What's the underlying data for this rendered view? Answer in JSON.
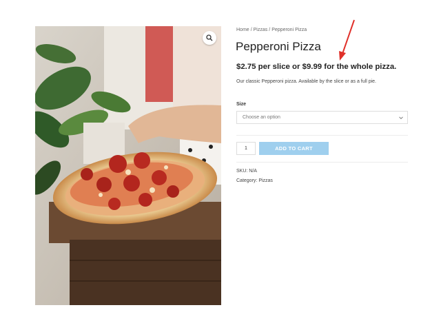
{
  "breadcrumb": {
    "home": "Home",
    "category": "Pizzas",
    "current": "Pepperoni Pizza",
    "separator": "/"
  },
  "product": {
    "title": "Pepperoni Pizza",
    "price_text": "$2.75 per slice or $9.99 for the whole pizza.",
    "description": "Our classic Pepperoni pizza. Available by the slice or as a full pie.",
    "image_icon": "pizza-photo"
  },
  "variation": {
    "label": "Size",
    "placeholder": "Choose an option"
  },
  "cart": {
    "quantity": "1",
    "button_label": "ADD TO CART"
  },
  "meta": {
    "sku_label": "SKU:",
    "sku_value": "N/A",
    "category_label": "Category:",
    "category_value": "Pizzas"
  },
  "icons": {
    "zoom": "magnifier-icon",
    "dropdown": "chevron-down-icon",
    "annotation": "red-arrow"
  },
  "colors": {
    "button": "#9fcfee",
    "arrow": "#e0302a",
    "text": "#222222"
  }
}
